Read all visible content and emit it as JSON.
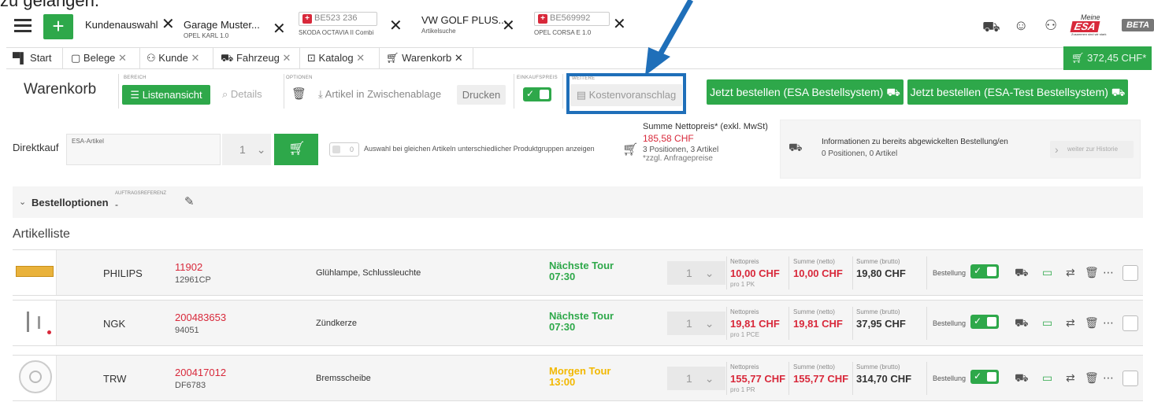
{
  "caption": "zu gelangen.",
  "top_tabs": [
    {
      "label": "Kundenauswahl",
      "sub": ""
    },
    {
      "label": "Garage Muster...",
      "sub": "OPEL KARL 1.0"
    },
    {
      "plate": "BE523 236",
      "sub": "SKODA OCTAVIA II Combi"
    },
    {
      "label": "VW GOLF PLUS...",
      "sub": "Artikelsuche"
    },
    {
      "plate": "BE569992",
      "sub": "OPEL CORSA E 1.0"
    }
  ],
  "logo": {
    "top": "Meine",
    "main": "ESA",
    "sub": "Zusammen sind wir stark"
  },
  "beta": "BETA",
  "nav": {
    "start": "Start",
    "belege": "Belege",
    "kunde": "Kunde",
    "fahrzeug": "Fahrzeug",
    "katalog": "Katalog",
    "warenkorb": "Warenkorb",
    "cart_total": "372,45 CHF*"
  },
  "toolbar": {
    "title": "Warenkorb",
    "bereich_label": "BEREICH",
    "listenansicht": "Listenansicht",
    "details": "Details",
    "optionen_label": "OPTIONEN",
    "clipboard": "Artikel in Zwischenablage",
    "drucken": "Drucken",
    "einkaufspreis_label": "EINKAUFSPREIS",
    "weiteres_label": "WEITERE",
    "kostenvoranschlag": "Kostenvoranschlag",
    "order_esa": "Jetzt bestellen (ESA Bestellsystem)",
    "order_test": "Jetzt bestellen (ESA-Test Bestellsystem)"
  },
  "direktkauf": {
    "label": "Direktkauf",
    "placeholder": "ESA-Artikel",
    "qty": "1",
    "switch_count": "0",
    "switch_desc": "Auswahl bei gleichen Artikeln unterschiedlicher Produktgruppen anzeigen"
  },
  "summary": {
    "title": "Summe Nettopreis* (exkl. MwSt)",
    "amount": "185,58 CHF",
    "positions": "3 Positionen, 3 Artikel",
    "note": "*zzgl. Anfragepreise"
  },
  "history": {
    "title": "Informationen zu bereits abgewickelten Bestellung/en",
    "counts": "0 Positionen,  0 Artikel",
    "link": "weiter zur Historie"
  },
  "bestelloptionen": {
    "label": "Bestelloptionen",
    "ref_label": "AUFTRAGSREFERENZ",
    "ref_value": "-"
  },
  "artikelliste": "Artikelliste",
  "col_labels": {
    "netto": "Nettopreis",
    "sum_netto": "Summe (netto)",
    "sum_brutto": "Summe (brutto)",
    "bestellung": "Bestellung"
  },
  "articles": [
    {
      "brand": "PHILIPS",
      "artno": "11902",
      "sub": "12961CP",
      "desc": "Glühlampe, Schlussleuchte",
      "tour": "Nächste Tour",
      "time": "07:30",
      "tour_color": "#2ea84a",
      "qty": "1",
      "netto": "10,00 CHF",
      "per": "pro 1 PK",
      "sum_netto": "10,00 CHF",
      "sum_brutto": "19,80 CHF"
    },
    {
      "brand": "NGK",
      "artno": "200483653",
      "sub": "94051",
      "desc": "Zündkerze",
      "tour": "Nächste Tour",
      "time": "07:30",
      "tour_color": "#2ea84a",
      "qty": "1",
      "netto": "19,81 CHF",
      "per": "pro 1 PCE",
      "sum_netto": "19,81 CHF",
      "sum_brutto": "37,95 CHF"
    },
    {
      "brand": "TRW",
      "artno": "200417012",
      "sub": "DF6783",
      "desc": "Bremsscheibe",
      "tour": "Morgen Tour",
      "time": "13:00",
      "tour_color": "#f2b800",
      "qty": "1",
      "netto": "155,77 CHF",
      "per": "pro 1 PR",
      "sum_netto": "155,77 CHF",
      "sum_brutto": "314,70 CHF"
    }
  ],
  "colors": {
    "green": "#2ea84a",
    "red": "#d8283a",
    "highlight": "#1f6fb9",
    "yellow": "#f2b800"
  }
}
